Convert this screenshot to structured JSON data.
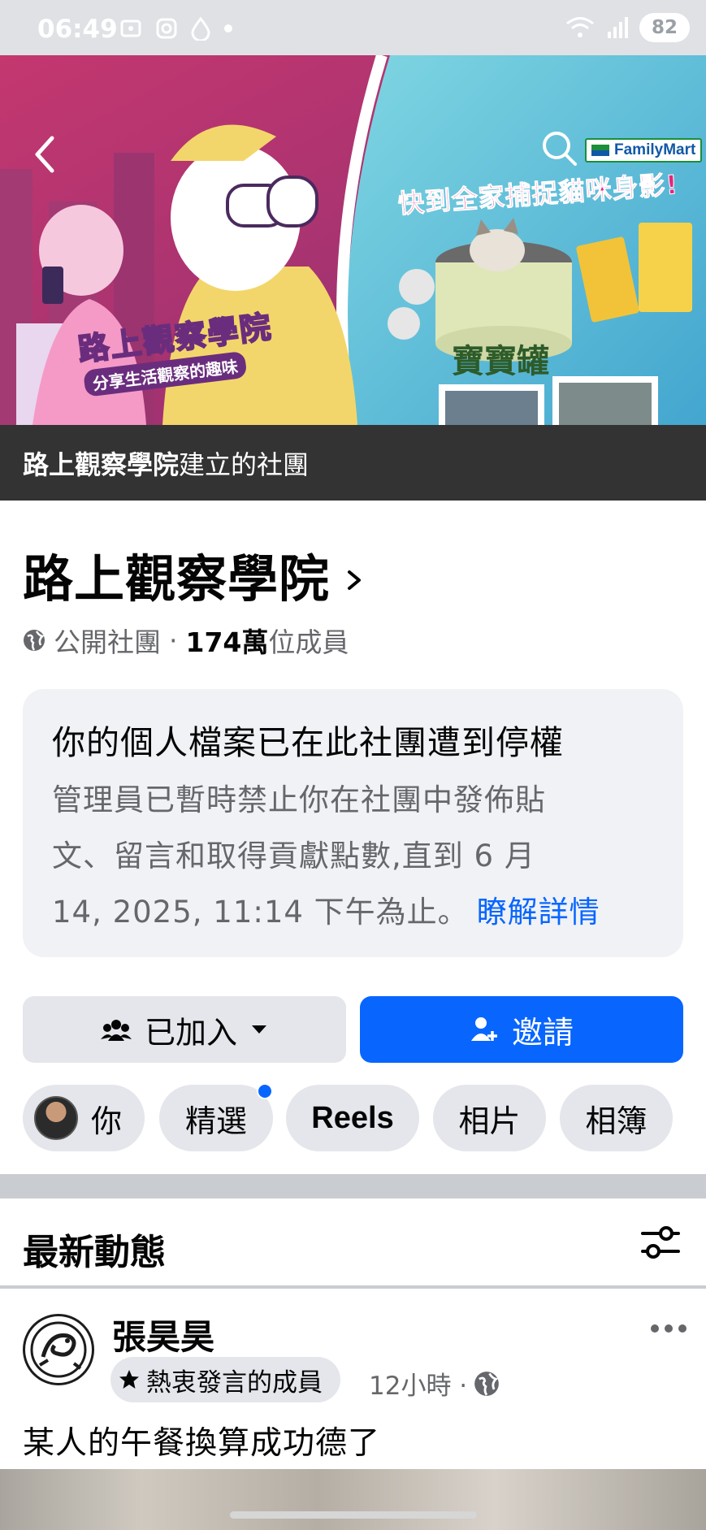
{
  "status_bar": {
    "time": "06:49",
    "battery": "82"
  },
  "cover": {
    "art_title": "路上觀察學院",
    "art_subtitle": "分享生活觀察的趣味",
    "promo_headline": "快到全家捕捉貓咪身影!",
    "promo_brand": "FamilyMart",
    "promo_product": "寶寶罐"
  },
  "creator": {
    "name": "路上觀察學院",
    "suffix": "建立的社團"
  },
  "group": {
    "name": "路上觀察學院",
    "privacy": "公開社團",
    "separator": "·",
    "member_count": "174萬",
    "member_label": "位成員"
  },
  "notice": {
    "title": "你的個人檔案已在此社團遭到停權",
    "body_line1": "管理員已暫時禁止你在社團中發佈貼",
    "body_line2": "文、留言和取得貢獻點數,直到 6 月",
    "body_line3": "14, 2025, 11:14 下午為止。",
    "link": "瞭解詳情"
  },
  "actions": {
    "joined_label": "已加入",
    "invite_label": "邀請"
  },
  "tabs": [
    {
      "label": "你"
    },
    {
      "label": "精選"
    },
    {
      "label": "Reels"
    },
    {
      "label": "相片"
    },
    {
      "label": "相簿"
    }
  ],
  "feed": {
    "header": "最新動態"
  },
  "post": {
    "author": "張昊昊",
    "badge": "熱衷發言的成員",
    "time": "12小時 ·",
    "text": "某人的午餐換算成功德了"
  },
  "icons": {
    "back": "chevron-left-icon",
    "search": "search-icon",
    "globe": "globe-icon",
    "group": "group-icon",
    "dropdown": "caret-down-icon",
    "invite": "add-person-icon",
    "filter": "filter-sliders-icon",
    "more": "more-horizontal-icon",
    "star": "star-icon"
  },
  "colors": {
    "accent": "#0866ff",
    "chip_bg": "#e4e6eb",
    "notice_bg": "#f0f2f5",
    "secondary_text": "#65676b"
  }
}
